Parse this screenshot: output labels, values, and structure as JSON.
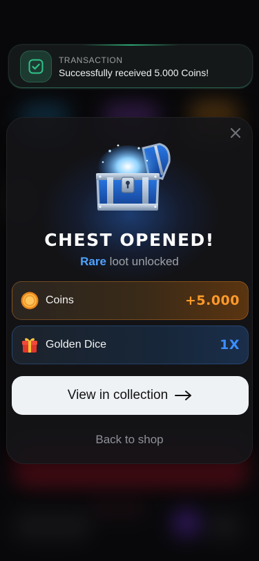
{
  "colors": {
    "success": "#2fc48a",
    "rare": "#4fa3ff",
    "coins": "#ff9a2a",
    "dice": "#3b8eff"
  },
  "toast": {
    "label": "TRANSACTION",
    "message": "Successfully received 5.000 Coins!",
    "icon": "checkmark-icon"
  },
  "modal": {
    "title": "CHEST OPENED!",
    "rarity": "Rare",
    "subtitle_rest": " loot unlocked",
    "rewards": [
      {
        "name": "Coins",
        "value": "+5.000",
        "icon": "coin-icon"
      },
      {
        "name": "Golden Dice",
        "value": "1X",
        "icon": "gift-icon"
      }
    ],
    "primary_label": "View in collection",
    "secondary_label": "Back to shop",
    "close_icon": "close-icon",
    "illustration": "treasure-chest-icon"
  }
}
